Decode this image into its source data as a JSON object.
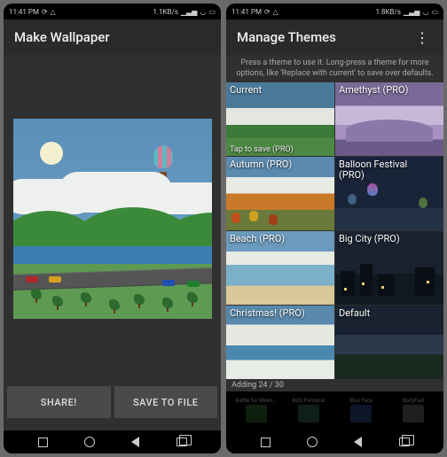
{
  "left": {
    "status": {
      "time": "11:41 PM",
      "speed": "1.1KB/s"
    },
    "title": "Make Wallpaper",
    "buttons": {
      "share": "SHARE!",
      "save": "SAVE TO FILE"
    }
  },
  "right": {
    "status": {
      "time": "11:41 PM",
      "speed": "1.8KB/s"
    },
    "title": "Manage Themes",
    "instructions": "Press a theme to use it. Long-press a theme for more options, like 'Replace with current' to save over defaults.",
    "themes": [
      {
        "name": "Current",
        "sub": "Tap to save (PRO)"
      },
      {
        "name": "Amethyst (PRO)"
      },
      {
        "name": "Autumn (PRO)"
      },
      {
        "name": "Balloon Festival (PRO)"
      },
      {
        "name": "Beach (PRO)"
      },
      {
        "name": "Big City (PRO)"
      },
      {
        "name": "Christmas! (PRO)"
      },
      {
        "name": "Default"
      }
    ],
    "adding": "Adding 24 / 30",
    "recents": [
      "Battle for Wesn...",
      "BDO Personal",
      "Blue Face",
      "BodyFast"
    ]
  }
}
